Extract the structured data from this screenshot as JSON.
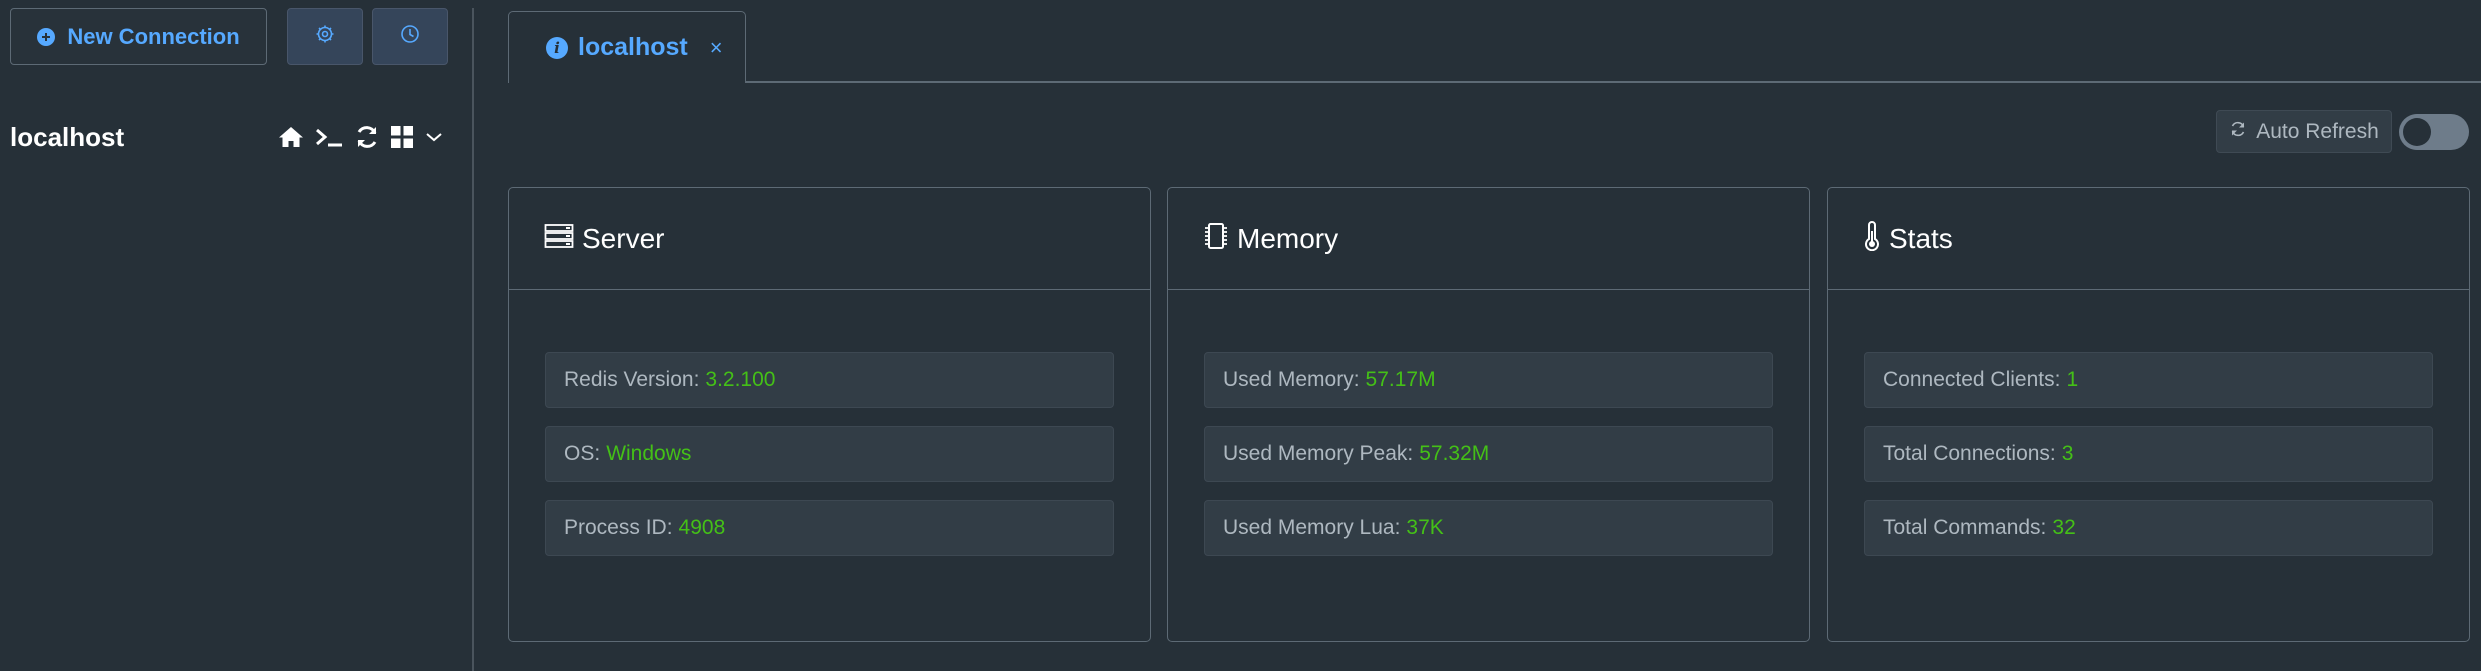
{
  "sidebar": {
    "new_connection_label": "New Connection",
    "settings_icon": "gear-icon",
    "history_icon": "clock-icon",
    "connection_name": "localhost",
    "tools": [
      "home-icon",
      "terminal-icon",
      "refresh-icon",
      "grid-icon",
      "chevron-down-icon"
    ]
  },
  "tabs": [
    {
      "label": "localhost",
      "icon": "info-icon",
      "close": "×"
    }
  ],
  "toolbar": {
    "auto_refresh_label": "Auto Refresh",
    "auto_refresh_on": false
  },
  "cards": {
    "server": {
      "title": "Server",
      "rows": [
        {
          "label": "Redis Version:",
          "value": "3.2.100"
        },
        {
          "label": "OS:",
          "value": "Windows"
        },
        {
          "label": "Process ID:",
          "value": "4908"
        }
      ]
    },
    "memory": {
      "title": "Memory",
      "rows": [
        {
          "label": "Used Memory:",
          "value": "57.17M"
        },
        {
          "label": "Used Memory Peak:",
          "value": "57.32M"
        },
        {
          "label": "Used Memory Lua:",
          "value": "37K"
        }
      ]
    },
    "stats": {
      "title": "Stats",
      "rows": [
        {
          "label": "Connected Clients:",
          "value": "1"
        },
        {
          "label": "Total Connections:",
          "value": "3"
        },
        {
          "label": "Total Commands:",
          "value": "32"
        }
      ]
    }
  },
  "colors": {
    "background": "#263038",
    "accent": "#56a9ff",
    "value": "#44c017",
    "border": "#5d6a75"
  }
}
